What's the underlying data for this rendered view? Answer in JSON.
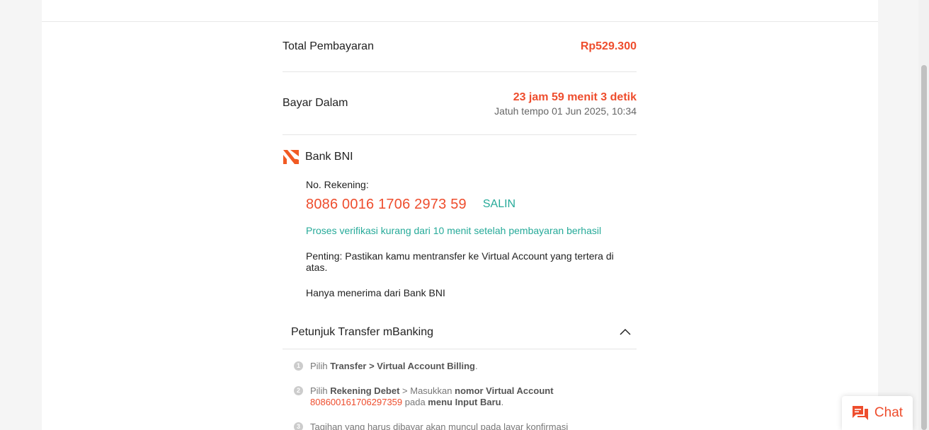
{
  "summary": {
    "total_label": "Total Pembayaran",
    "total_amount": "Rp529.300",
    "pay_within_label": "Bayar Dalam",
    "countdown": "23 jam 59 menit 3 detik",
    "due_date": "Jatuh tempo 01 Jun 2025, 10:34"
  },
  "bank": {
    "name": "Bank BNI",
    "account_label": "No. Rekening:",
    "account_number": "8086 0016 1706 2973 59",
    "copy_label": "SALIN",
    "verify_note": "Proses verifikasi kurang dari 10 menit setelah pembayaran berhasil",
    "important_note": "Penting: Pastikan kamu mentransfer ke Virtual Account yang tertera di atas.",
    "accept_note": "Hanya menerima dari Bank BNI"
  },
  "guide": {
    "title": "Petunjuk Transfer mBanking",
    "steps": [
      {
        "num": "1",
        "t1": "Pilih ",
        "b1": "Transfer > Virtual Account Billing",
        "t2": "."
      },
      {
        "num": "2",
        "t1": "Pilih ",
        "b1": "Rekening Debet",
        "t2": " > Masukkan ",
        "b2": "nomor Virtual Account",
        "va": "808600161706297359",
        "t3": " pada ",
        "b3": "menu Input Baru",
        "t4": "."
      },
      {
        "num": "3",
        "t1": "Tagihan yang harus dibayar akan muncul pada layar konfirmasi"
      }
    ]
  },
  "chat": {
    "label": "Chat"
  },
  "colors": {
    "accent": "#ee4d2d",
    "teal": "#26aa99"
  }
}
